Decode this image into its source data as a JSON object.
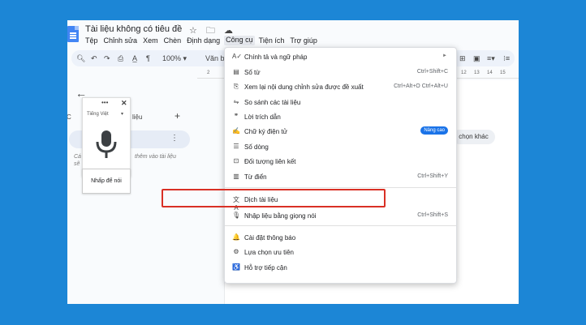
{
  "window": {
    "doc_title": "Tài liệu không có tiêu đề",
    "title_icons": "☆ 🗀 ☁",
    "menu": [
      "Tệp",
      "Chỉnh sửa",
      "Xem",
      "Chèn",
      "Định dạng",
      "Công cụ",
      "Tiện ích",
      "Trợ giúp"
    ],
    "active_menu_index": 5
  },
  "toolbar": {
    "zoom": "100%",
    "zoom_caret": "▾",
    "style_label": "Văn b",
    "search_icon": "search-icon",
    "undo_icon": "undo-icon",
    "redo_icon": "redo-icon",
    "print_icon": "print-icon",
    "spellcheck_icon": "spellcheck-icon",
    "paint_icon": "paint-format-icon",
    "right_icons": [
      "⊞",
      "▣",
      "≡▾",
      "⁝≡"
    ]
  },
  "ruler": {
    "ticks": [
      "2",
      "12",
      "13",
      "14",
      "15"
    ]
  },
  "outline": {
    "back": "←",
    "label_prefix": "C",
    "label": "liệu",
    "add": "+",
    "more": "⋮",
    "hint_left": "Cá\nsẽ",
    "hint_right": "thêm vào tài liệu"
  },
  "voice": {
    "more": "•••",
    "close": "✕",
    "language": "Tiếng Việt",
    "caret": "▾",
    "tooltip": "Nhấp để nói"
  },
  "chip_other": "chọn khác",
  "tools_menu": {
    "items": [
      {
        "icon": "A✓",
        "label": "Chính tả và ngữ pháp",
        "shortcut": "",
        "submenu": "►"
      },
      {
        "icon": "▤",
        "label": "Số từ",
        "shortcut": "Ctrl+Shift+C"
      },
      {
        "icon": "⎘",
        "label": "Xem lại nội dung chỉnh sửa được đề xuất",
        "shortcut": "Ctrl+Alt+O Ctrl+Alt+U"
      },
      {
        "icon": "⇋",
        "label": "So sánh các tài liệu",
        "shortcut": ""
      },
      {
        "icon": "❞",
        "label": "Lời trích dẫn",
        "shortcut": ""
      },
      {
        "icon": "✍",
        "label": "Chữ ký điện tử",
        "shortcut": "",
        "badge": "Nâng cao"
      },
      {
        "icon": "☰",
        "label": "Số dòng",
        "shortcut": ""
      },
      {
        "icon": "⊡",
        "label": "Đối tượng liên kết",
        "shortcut": ""
      },
      {
        "icon": "▥",
        "label": "Từ điển",
        "shortcut": "Ctrl+Shift+Y"
      },
      {
        "icon": "文A",
        "label": "Dịch tài liệu",
        "shortcut": ""
      },
      {
        "icon": "🎙",
        "label": "Nhập liệu bằng giọng nói",
        "shortcut": "Ctrl+Shift+S"
      },
      {
        "icon": "🔔",
        "label": "Cài đặt thông báo",
        "shortcut": ""
      },
      {
        "icon": "⚙",
        "label": "Lựa chọn ưu tiên",
        "shortcut": ""
      },
      {
        "icon": "♿",
        "label": "Hỗ trợ tiếp cận",
        "shortcut": ""
      }
    ],
    "highlighted_index": 10,
    "highlight_color": "#d93025",
    "badge_color": "#1a73e8"
  }
}
